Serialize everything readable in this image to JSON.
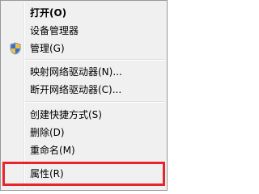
{
  "context_menu": {
    "items": [
      {
        "label": "打开(O)",
        "bold": true,
        "icon": null
      },
      {
        "label": "设备管理器",
        "bold": false,
        "icon": null
      },
      {
        "label": "管理(G)",
        "bold": false,
        "icon": "uac-shield-icon"
      },
      {
        "label": "映射网络驱动器(N)...",
        "bold": false,
        "icon": null
      },
      {
        "label": "断开网络驱动器(C)...",
        "bold": false,
        "icon": null
      },
      {
        "label": "创建快捷方式(S)",
        "bold": false,
        "icon": null
      },
      {
        "label": "删除(D)",
        "bold": false,
        "icon": null
      },
      {
        "label": "重命名(M)",
        "bold": false,
        "icon": null
      },
      {
        "label": "属性(R)",
        "bold": false,
        "icon": null
      }
    ]
  },
  "highlight": {
    "target": "属性(R)",
    "color": "#e8242f"
  },
  "colors": {
    "menu_background": "#f0f0f0",
    "menu_border": "#979797",
    "text": "#000000"
  }
}
